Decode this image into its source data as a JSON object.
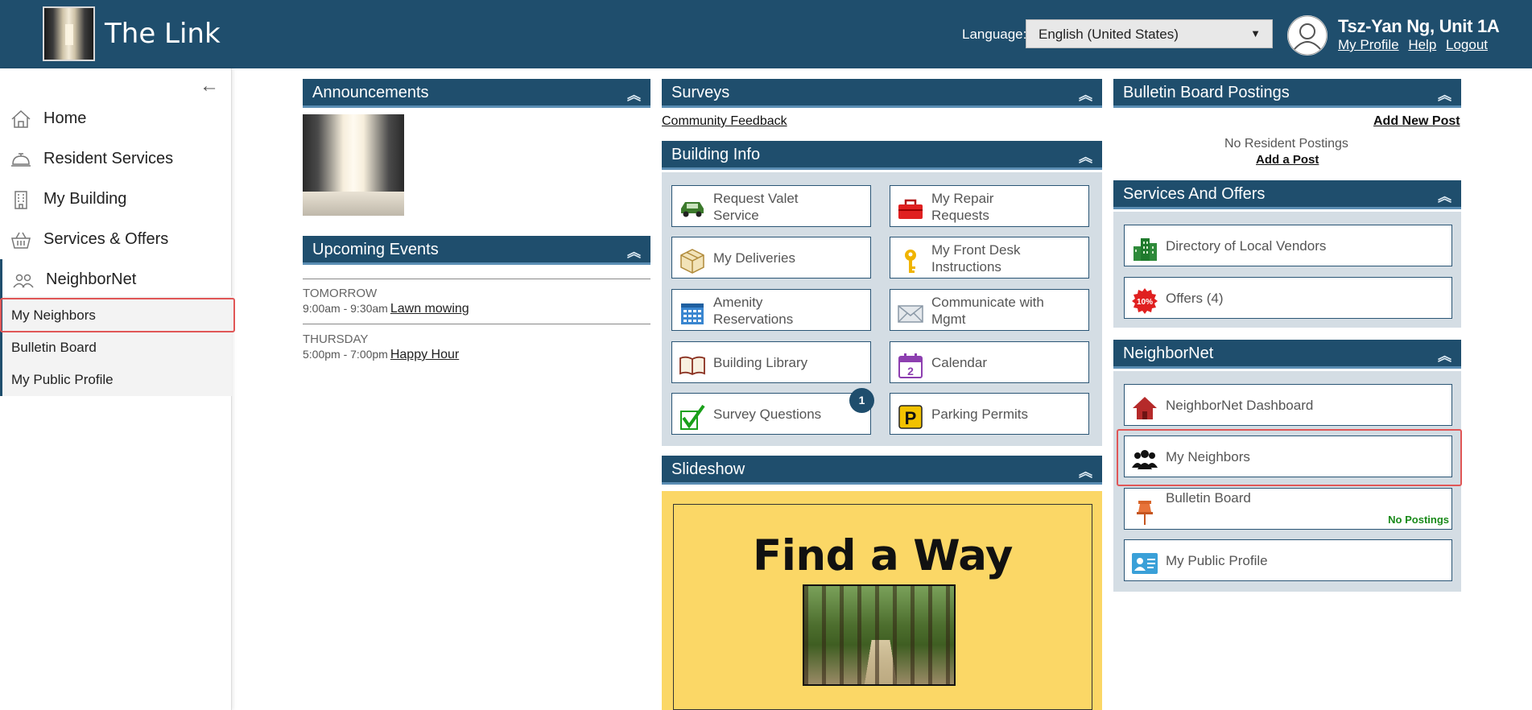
{
  "header": {
    "app_title": "The Link",
    "language_label": "Language:",
    "language_value": "English (United States)",
    "user_name": "Tsz-Yan Ng, Unit 1A",
    "links": [
      "My Profile",
      "Help",
      "Logout"
    ]
  },
  "sidebar": {
    "collapse": "←",
    "items": [
      {
        "label": "Home",
        "icon": "home-icon"
      },
      {
        "label": "Resident Services",
        "icon": "bell-icon"
      },
      {
        "label": "My Building",
        "icon": "building-icon"
      },
      {
        "label": "Services & Offers",
        "icon": "basket-icon"
      },
      {
        "label": "NeighborNet",
        "icon": "people-icon"
      }
    ],
    "subitems": [
      "My Neighbors",
      "Bulletin Board",
      "My Public Profile"
    ]
  },
  "announcements": {
    "title": "Announcements"
  },
  "events": {
    "title": "Upcoming Events",
    "items": [
      {
        "day": "TOMORROW",
        "time": "9:00am - 9:30am",
        "name": "Lawn mowing"
      },
      {
        "day": "THURSDAY",
        "time": "5:00pm - 7:00pm",
        "name": "Happy Hour"
      }
    ]
  },
  "surveys": {
    "title": "Surveys",
    "link": "Community Feedback"
  },
  "building_info": {
    "title": "Building Info",
    "tiles": [
      {
        "label": "Request Valet Service",
        "icon": "car-icon"
      },
      {
        "label": "My Repair Requests",
        "icon": "toolbox-icon"
      },
      {
        "label": "My Deliveries",
        "icon": "package-icon"
      },
      {
        "label": "My Front Desk Instructions",
        "icon": "key-icon"
      },
      {
        "label": "Amenity Reservations",
        "icon": "calendar-grid-icon"
      },
      {
        "label": "Communicate with Mgmt",
        "icon": "envelope-icon"
      },
      {
        "label": "Building Library",
        "icon": "book-icon"
      },
      {
        "label": "Calendar",
        "icon": "calendar-icon"
      },
      {
        "label": "Survey Questions",
        "icon": "checkmark-icon",
        "badge": "1"
      },
      {
        "label": "Parking Permits",
        "icon": "parking-icon"
      }
    ]
  },
  "slideshow": {
    "title": "Slideshow",
    "slide_title": "Find a Way"
  },
  "bulletin": {
    "title": "Bulletin Board Postings",
    "add_new": "Add New Post",
    "empty": "No Resident Postings",
    "add_a": "Add a Post"
  },
  "services": {
    "title": "Services And Offers",
    "tiles": [
      {
        "label": "Directory of Local Vendors",
        "icon": "city-icon"
      },
      {
        "label": "Offers (4)",
        "icon": "discount-icon",
        "badge_text": "10%"
      }
    ]
  },
  "neighbornet": {
    "title": "NeighborNet",
    "tiles": [
      {
        "label": "NeighborNet Dashboard",
        "icon": "house-icon"
      },
      {
        "label": "My Neighbors",
        "icon": "group-icon"
      },
      {
        "label": "Bulletin Board",
        "icon": "pushpin-icon",
        "status": "No Postings"
      },
      {
        "label": "My Public Profile",
        "icon": "id-card-icon"
      }
    ]
  }
}
